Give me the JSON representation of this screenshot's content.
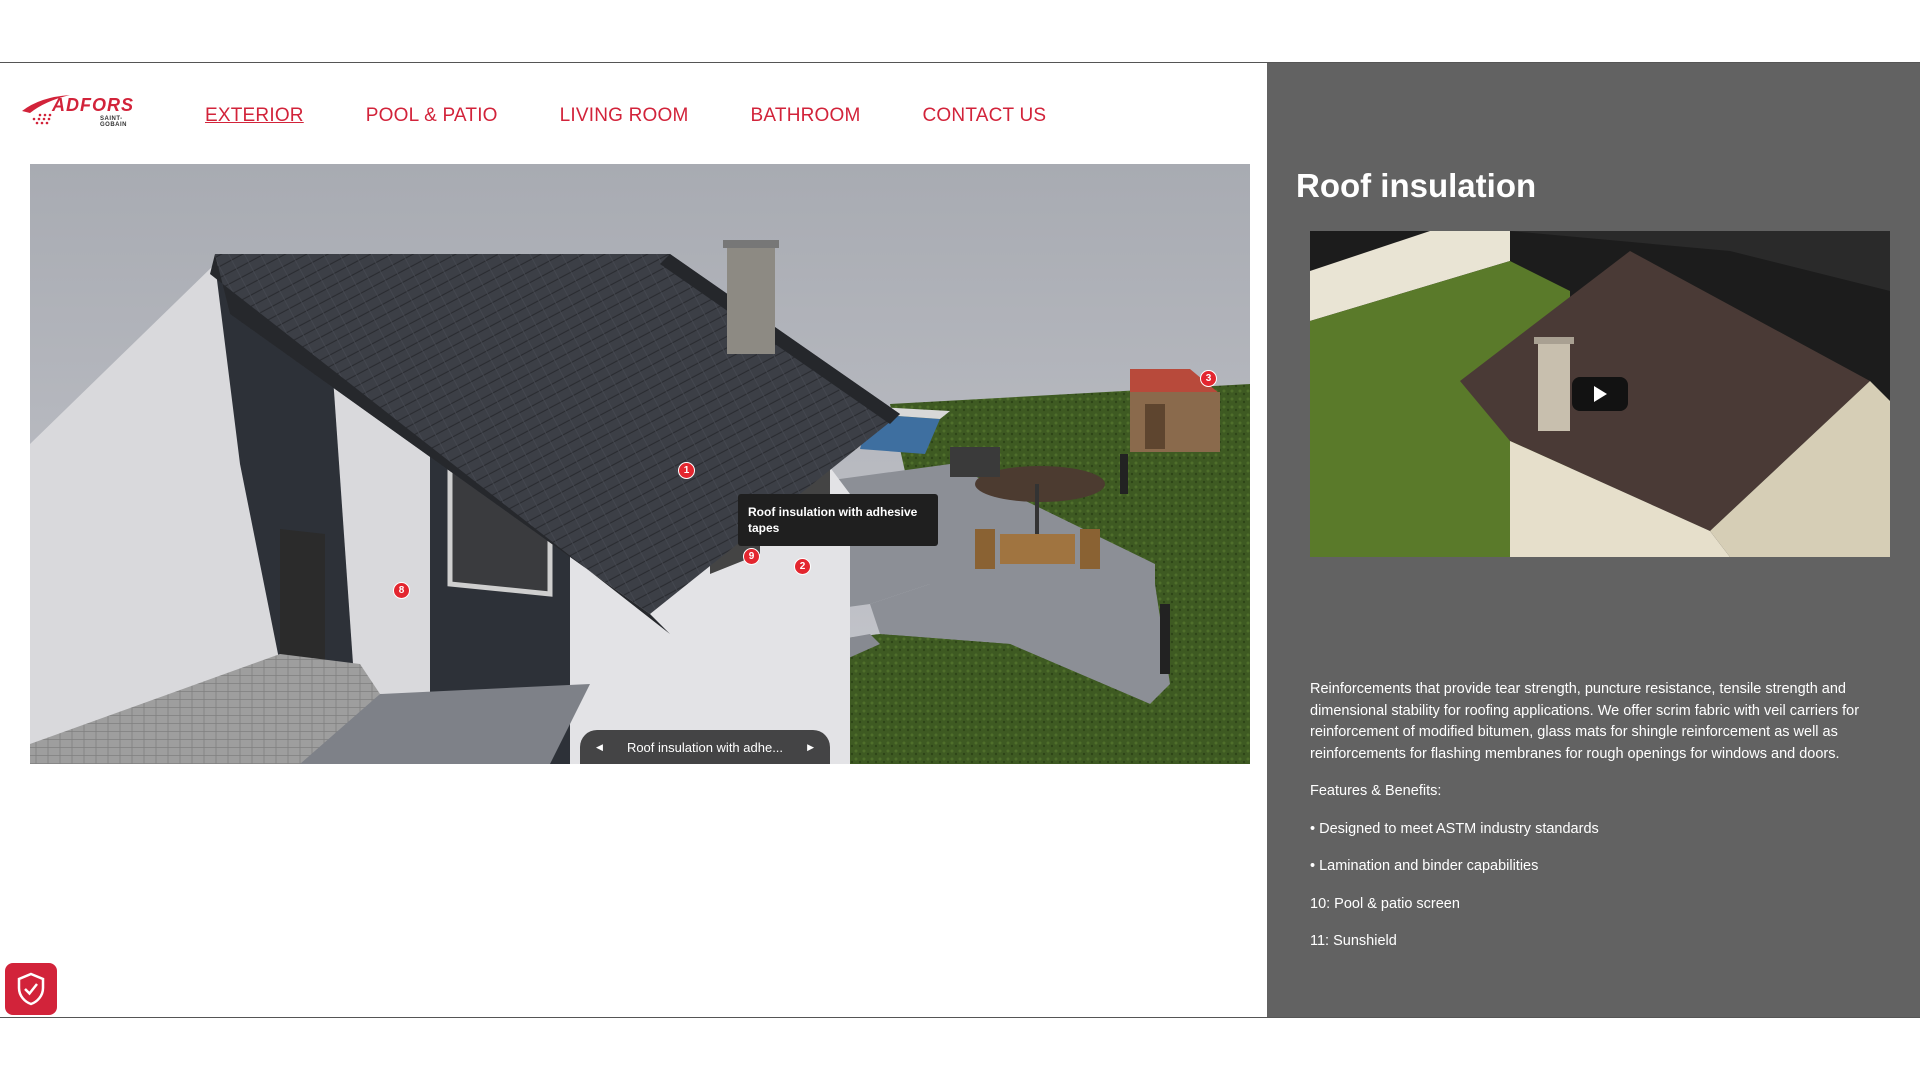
{
  "brand": {
    "name": "ADFORS",
    "subtitle": "SAINT-GOBAIN",
    "color": "#d2233a"
  },
  "nav": {
    "items": [
      {
        "label": "EXTERIOR",
        "active": true
      },
      {
        "label": "POOL & PATIO",
        "active": false
      },
      {
        "label": "LIVING ROOM",
        "active": false
      },
      {
        "label": "BATHROOM",
        "active": false
      },
      {
        "label": "CONTACT US",
        "active": false
      }
    ]
  },
  "viewer": {
    "hotspots": [
      "1",
      "2",
      "3",
      "8",
      "9"
    ],
    "tooltip": "Roof insulation with adhesive tapes",
    "carousel_label": "Roof insulation with adhe..."
  },
  "panel": {
    "title": "Roof insulation",
    "background": "#626262",
    "video_icon": "play-icon",
    "description": "Reinforcements that provide tear strength, puncture resistance, tensile strength and dimensional stability for roofing applications. We offer scrim fabric with veil carriers for reinforcement of modified bitumen, glass mats for shingle reinforcement as well as reinforcements for flashing membranes for rough openings for windows and doors.",
    "features_heading": "Features & Benefits:",
    "features": [
      "• Designed to meet ASTM industry standards",
      "• Lamination and binder capabilities"
    ],
    "links": [
      "10: Pool & patio screen",
      "11: Sunshield"
    ]
  },
  "privacy": {
    "icon": "shield-check-icon"
  }
}
